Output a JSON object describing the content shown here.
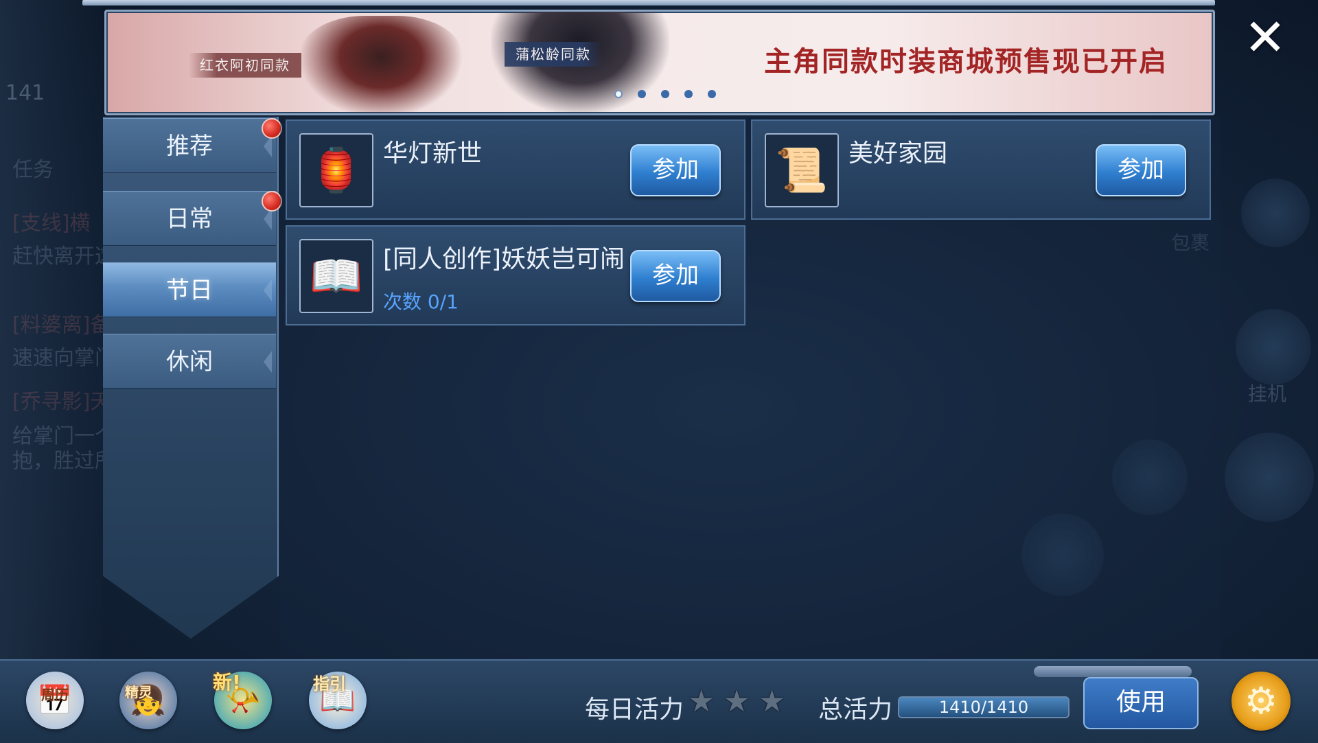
{
  "background": {
    "left_number": "141",
    "left_texts": [
      {
        "text": "任务",
        "red": false
      },
      {
        "text": "[支线]横",
        "red": true
      },
      {
        "text": "赶快离开这个鬼地方，回",
        "red": false
      },
      {
        "text": "[料婆离]备",
        "red": true
      },
      {
        "text": "速速向掌门禀报",
        "red": false
      },
      {
        "text": "[乔寻影]天上恒梦",
        "red": true
      },
      {
        "text": "给掌门一个大大的拥",
        "red": false
      },
      {
        "text": "抱，胜过所他防卫",
        "red": false
      }
    ],
    "right_labels": [
      "包裹",
      "挂机"
    ]
  },
  "banner": {
    "tag_1": "红衣阿初同款",
    "tag_2": "蒲松龄同款",
    "headline": "主角同款时装商城预售现已开启",
    "dots": 5,
    "active_dot": 0
  },
  "close_label": "✕",
  "sidebar": {
    "tabs": [
      {
        "label": "推荐",
        "badge": true,
        "active": false
      },
      {
        "label": "日常",
        "badge": true,
        "active": false
      },
      {
        "label": "节日",
        "badge": false,
        "active": true
      },
      {
        "label": "休闲",
        "badge": false,
        "active": false
      }
    ]
  },
  "events": [
    {
      "title": "华灯新世",
      "subtitle": "",
      "button": "参加",
      "icon": "lantern-icon",
      "glyph": "🏮"
    },
    {
      "title": "美好家园",
      "subtitle": "",
      "button": "参加",
      "icon": "scroll-icon",
      "glyph": "📜"
    },
    {
      "title": "[同人创作]妖妖岂可闹",
      "subtitle": "次数 0/1",
      "button": "参加",
      "icon": "book-icon",
      "glyph": "📖"
    }
  ],
  "bottom": {
    "icons": [
      {
        "name": "weekly-calendar-icon",
        "label": "周历"
      },
      {
        "name": "spirit-icon",
        "label": "精灵"
      },
      {
        "name": "new-feature-icon",
        "label": "新!"
      },
      {
        "name": "guide-icon",
        "label": "指引"
      }
    ],
    "daily_label": "每日活力",
    "stars": 3,
    "total_label": "总活力",
    "vitality_text": "1410/1410",
    "vitality_fraction": 1.0,
    "use_label": "使用",
    "settings_glyph": "⚙"
  }
}
